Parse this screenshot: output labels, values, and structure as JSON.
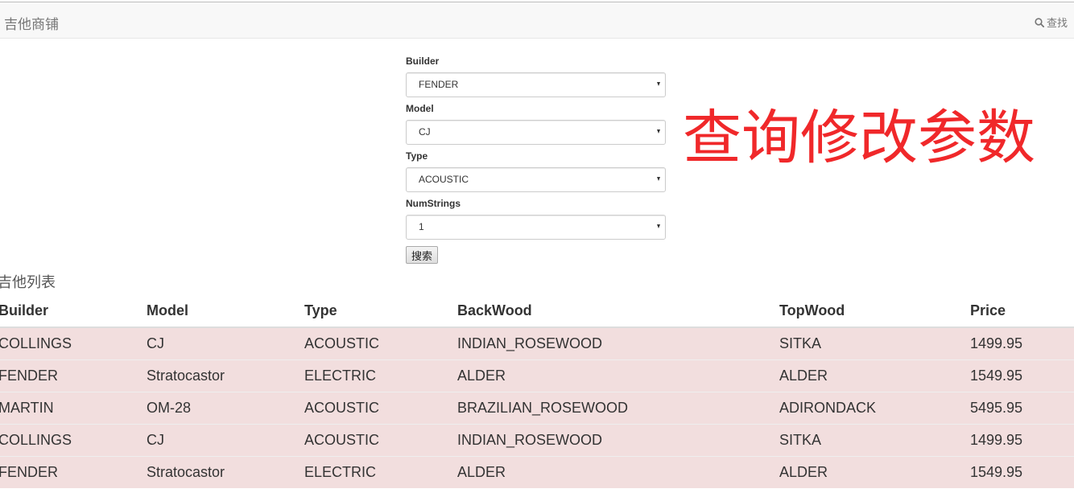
{
  "navbar": {
    "brand": "吉他商铺",
    "search_label": "查找"
  },
  "form": {
    "builder": {
      "label": "Builder",
      "value": "FENDER"
    },
    "model": {
      "label": "Model",
      "value": "CJ"
    },
    "type": {
      "label": "Type",
      "value": "ACOUSTIC"
    },
    "num_strings": {
      "label": "NumStrings",
      "value": "1"
    },
    "submit_label": "搜索"
  },
  "annotation": "查询修改参数",
  "list": {
    "title": "吉他列表",
    "headers": [
      "Builder",
      "Model",
      "Type",
      "BackWood",
      "TopWood",
      "Price"
    ],
    "rows": [
      [
        "COLLINGS",
        "CJ",
        "ACOUSTIC",
        "INDIAN_ROSEWOOD",
        "SITKA",
        "1499.95"
      ],
      [
        "FENDER",
        "Stratocastor",
        "ELECTRIC",
        "ALDER",
        "ALDER",
        "1549.95"
      ],
      [
        "MARTIN",
        "OM-28",
        "ACOUSTIC",
        "BRAZILIAN_ROSEWOOD",
        "ADIRONDACK",
        "5495.95"
      ],
      [
        "COLLINGS",
        "CJ",
        "ACOUSTIC",
        "INDIAN_ROSEWOOD",
        "SITKA",
        "1499.95"
      ],
      [
        "FENDER",
        "Stratocastor",
        "ELECTRIC",
        "ALDER",
        "ALDER",
        "1549.95"
      ]
    ]
  },
  "colors": {
    "row_highlight": "#f2dede",
    "annotation": "#f0282a",
    "navbar_bg": "#f8f8f8"
  },
  "icons": {
    "search": "magnifier"
  }
}
